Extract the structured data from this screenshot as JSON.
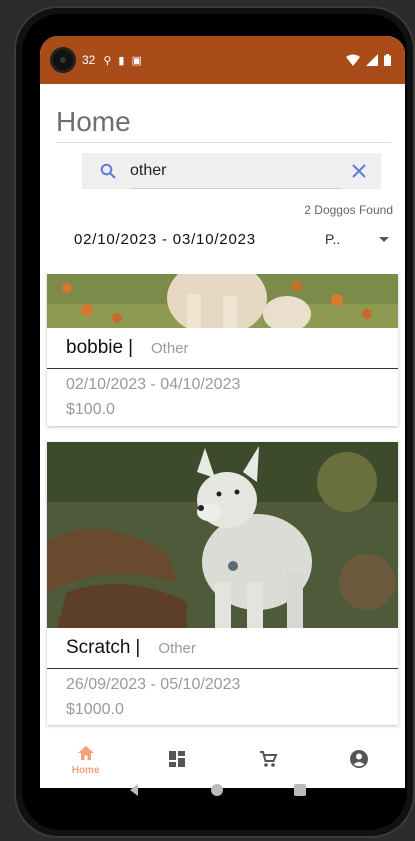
{
  "status_bar": {
    "time": "32"
  },
  "header": {
    "title": "Home"
  },
  "search": {
    "value": "other"
  },
  "results": {
    "found_text": "2 Doggos Found"
  },
  "filters": {
    "date_range": "02/10/2023 - 03/10/2023",
    "sort_value": "P.."
  },
  "listings": [
    {
      "name": "bobbie",
      "separator": "|",
      "category": "Other",
      "dates": "02/10/2023 - 04/10/2023",
      "price": "$100.0"
    },
    {
      "name": "Scratch",
      "separator": "|",
      "category": "Other",
      "dates": "26/09/2023 - 05/10/2023",
      "price": "$1000.0"
    }
  ],
  "bottom_nav": {
    "active_label": "Home",
    "items": [
      "home-icon",
      "dashboard-icon",
      "cart-icon",
      "account-icon"
    ]
  },
  "colors": {
    "status_bar": "#a94c1a",
    "nav_active": "#f4a27a",
    "accent": "#5b7fe0"
  }
}
